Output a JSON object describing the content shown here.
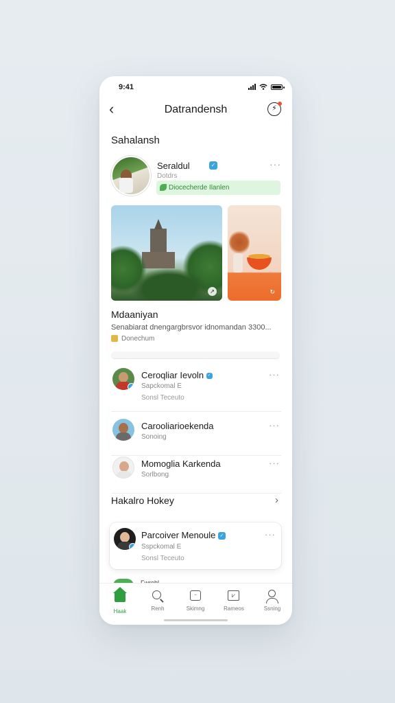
{
  "status": {
    "time": "9:41"
  },
  "nav": {
    "title": "Datrandensh",
    "back_icon": "chevron-left-icon",
    "action_icon": "compass-icon"
  },
  "section_title": "Sahalansh",
  "post": {
    "name": "Seraldul",
    "sub": "Dotdrs",
    "tag": "Diocecherde Ilanlen",
    "caption_title": "Mdaaniyan",
    "caption_text": "Senabiarat dnengargbrsvor idnomandan 3300...",
    "location": "Donechum"
  },
  "users": [
    {
      "name": "Ceroqliar Ievoln",
      "sub": "Sapckomal E",
      "sub2": "Sonsl Teceuto",
      "verified": true
    },
    {
      "name": "Carooliarioekenda",
      "sub": "Sonoing"
    },
    {
      "name": "Momoglia Karkenda",
      "sub": "Sorlbong"
    }
  ],
  "section2": {
    "title": "Hakalro Hokey"
  },
  "card": {
    "name": "Parcoiver Menoule",
    "sub": "Sspckomal E",
    "sub2": "Sonsl Teceuto"
  },
  "peek": {
    "text": "Fwrohl"
  },
  "tabs": [
    {
      "label": "Haak",
      "icon": "home-icon",
      "active": true
    },
    {
      "label": "Renh",
      "icon": "search-icon",
      "active": false
    },
    {
      "label": "Skimng",
      "icon": "chat-icon",
      "active": false
    },
    {
      "label": "Rameos",
      "icon": "chart-icon",
      "active": false
    },
    {
      "label": "Ssning",
      "icon": "profile-icon",
      "active": false
    }
  ],
  "colors": {
    "accent_green": "#2e9e3f",
    "tag_bg": "#def5df",
    "verified_blue": "#3aa3e0",
    "notification_red": "#e4553d"
  }
}
